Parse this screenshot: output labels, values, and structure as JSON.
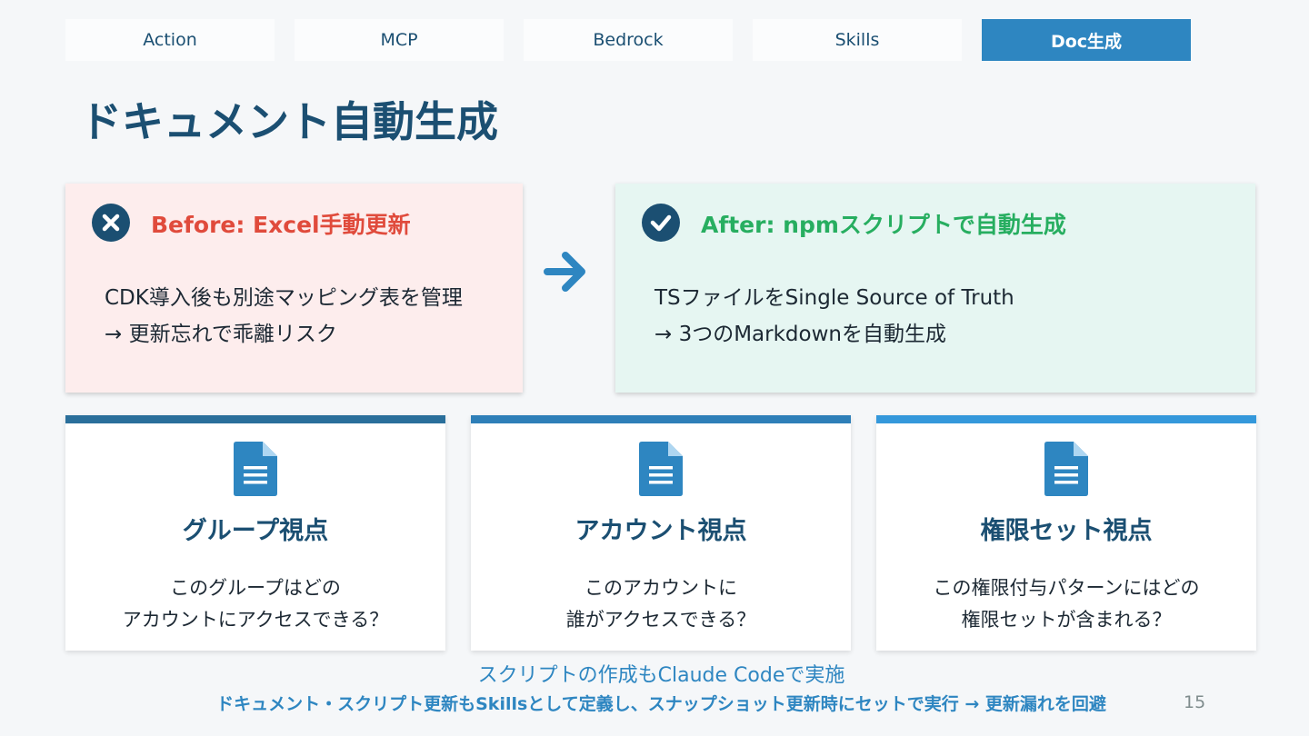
{
  "nav": {
    "tabs": [
      {
        "label": "Action"
      },
      {
        "label": "MCP"
      },
      {
        "label": "Bedrock"
      },
      {
        "label": "Skills"
      },
      {
        "label": "Doc生成"
      }
    ],
    "active_tab": "Doc生成"
  },
  "title": "ドキュメント自動生成",
  "before": {
    "heading": "Before: Excel手動更新",
    "icon": "x-circle-icon",
    "lines": [
      "CDK導入後も別途マッピング表を管理",
      "→ 更新忘れで乖離リスク"
    ]
  },
  "after": {
    "heading": "After: npmスクリプトで自動生成",
    "icon": "check-circle-icon",
    "lines": [
      "TSファイルをSingle Source of Truth",
      "→ 3つのMarkdownを自動生成"
    ]
  },
  "cards": [
    {
      "icon": "document-icon",
      "title": "グループ視点",
      "lines": [
        "このグループはどの",
        "アカウントにアクセスできる？"
      ]
    },
    {
      "icon": "document-icon",
      "title": "アカウント視点",
      "lines": [
        "このアカウントに",
        "誰がアクセスできる？"
      ]
    },
    {
      "icon": "document-icon",
      "title": "権限セット視点",
      "lines": [
        "この権限付与パターンにはどの",
        "権限セットが含まれる？"
      ]
    }
  ],
  "footer": {
    "note": "スクリプトの作成もClaude Codeで実施",
    "main": "ドキュメント・スクリプト更新もSkillsとして定義し、スナップショット更新時にセットで実行 → 更新漏れを回避",
    "page_number": "15"
  },
  "colors": {
    "primary": "#1b4f72",
    "accent": "#2e86c1",
    "before_red": "#e04b3c",
    "after_green": "#27ae60"
  }
}
